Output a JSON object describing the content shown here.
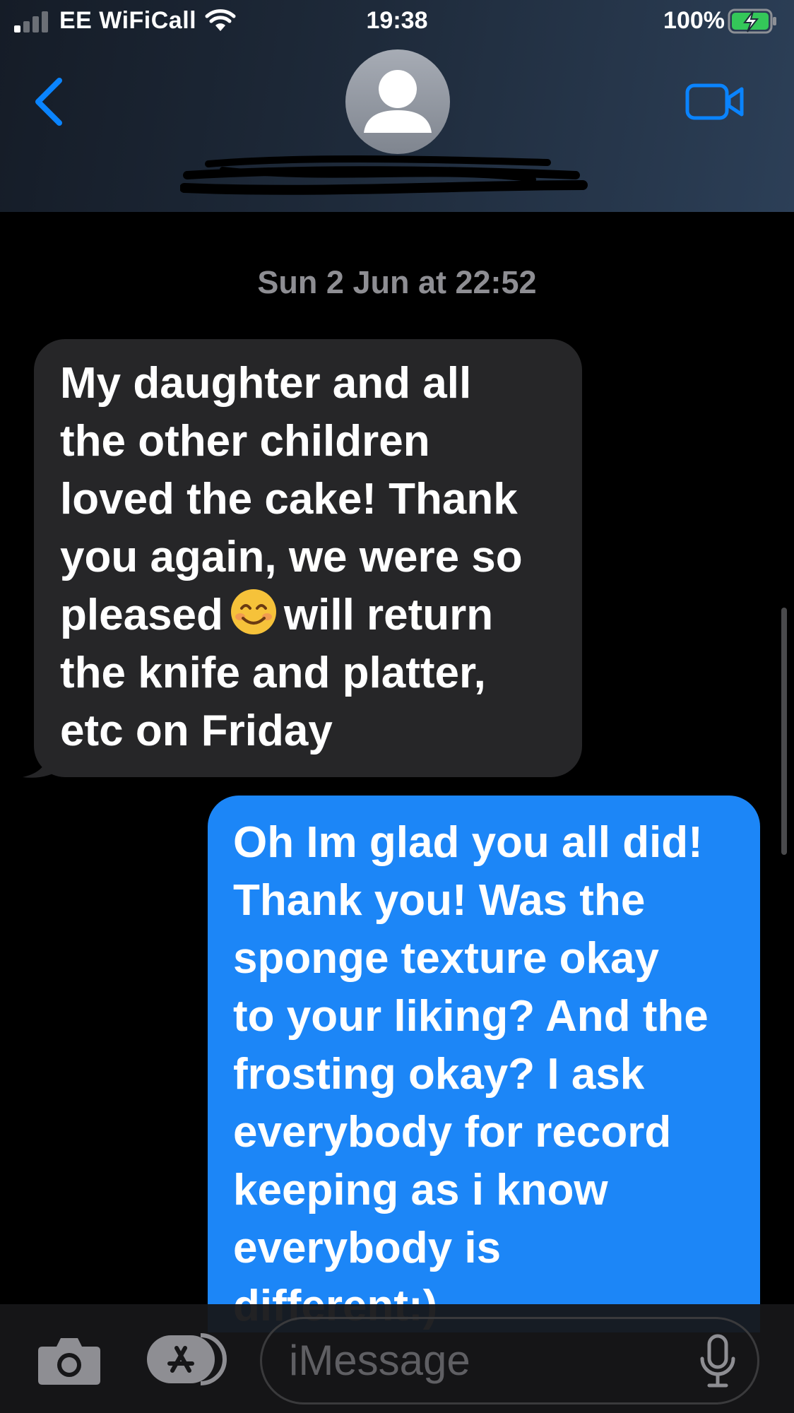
{
  "status_bar": {
    "carrier": "EE WiFiCall",
    "time": "19:38",
    "battery": "100%"
  },
  "header": {
    "contact_name_redacted": true,
    "back_icon": "chevron-left-icon",
    "video_icon": "video-camera-icon"
  },
  "conversation": {
    "timestamp": "Sun 2 Jun at 22:52",
    "incoming": {
      "lines": [
        "My daughter and all",
        "the other  children",
        "loved the cake! Thank",
        "you again, we were so",
        "pleased",
        "will return",
        "the knife and platter,",
        "etc on Friday"
      ]
    },
    "outgoing": {
      "lines": [
        "Oh Im glad you all did!",
        "Thank you! Was the",
        "sponge texture okay",
        "to your liking? And the",
        "frosting okay? I ask",
        "everybody for record",
        "keeping as i know",
        "everybody is",
        "different:)"
      ]
    }
  },
  "composer": {
    "placeholder": "iMessage",
    "camera_icon": "camera-icon",
    "apps_icon": "app-store-icon",
    "mic_icon": "microphone-icon"
  },
  "colors": {
    "incoming_bubble": "#262628",
    "outgoing_bubble": "#1c86f7",
    "accent": "#0a84ff"
  }
}
